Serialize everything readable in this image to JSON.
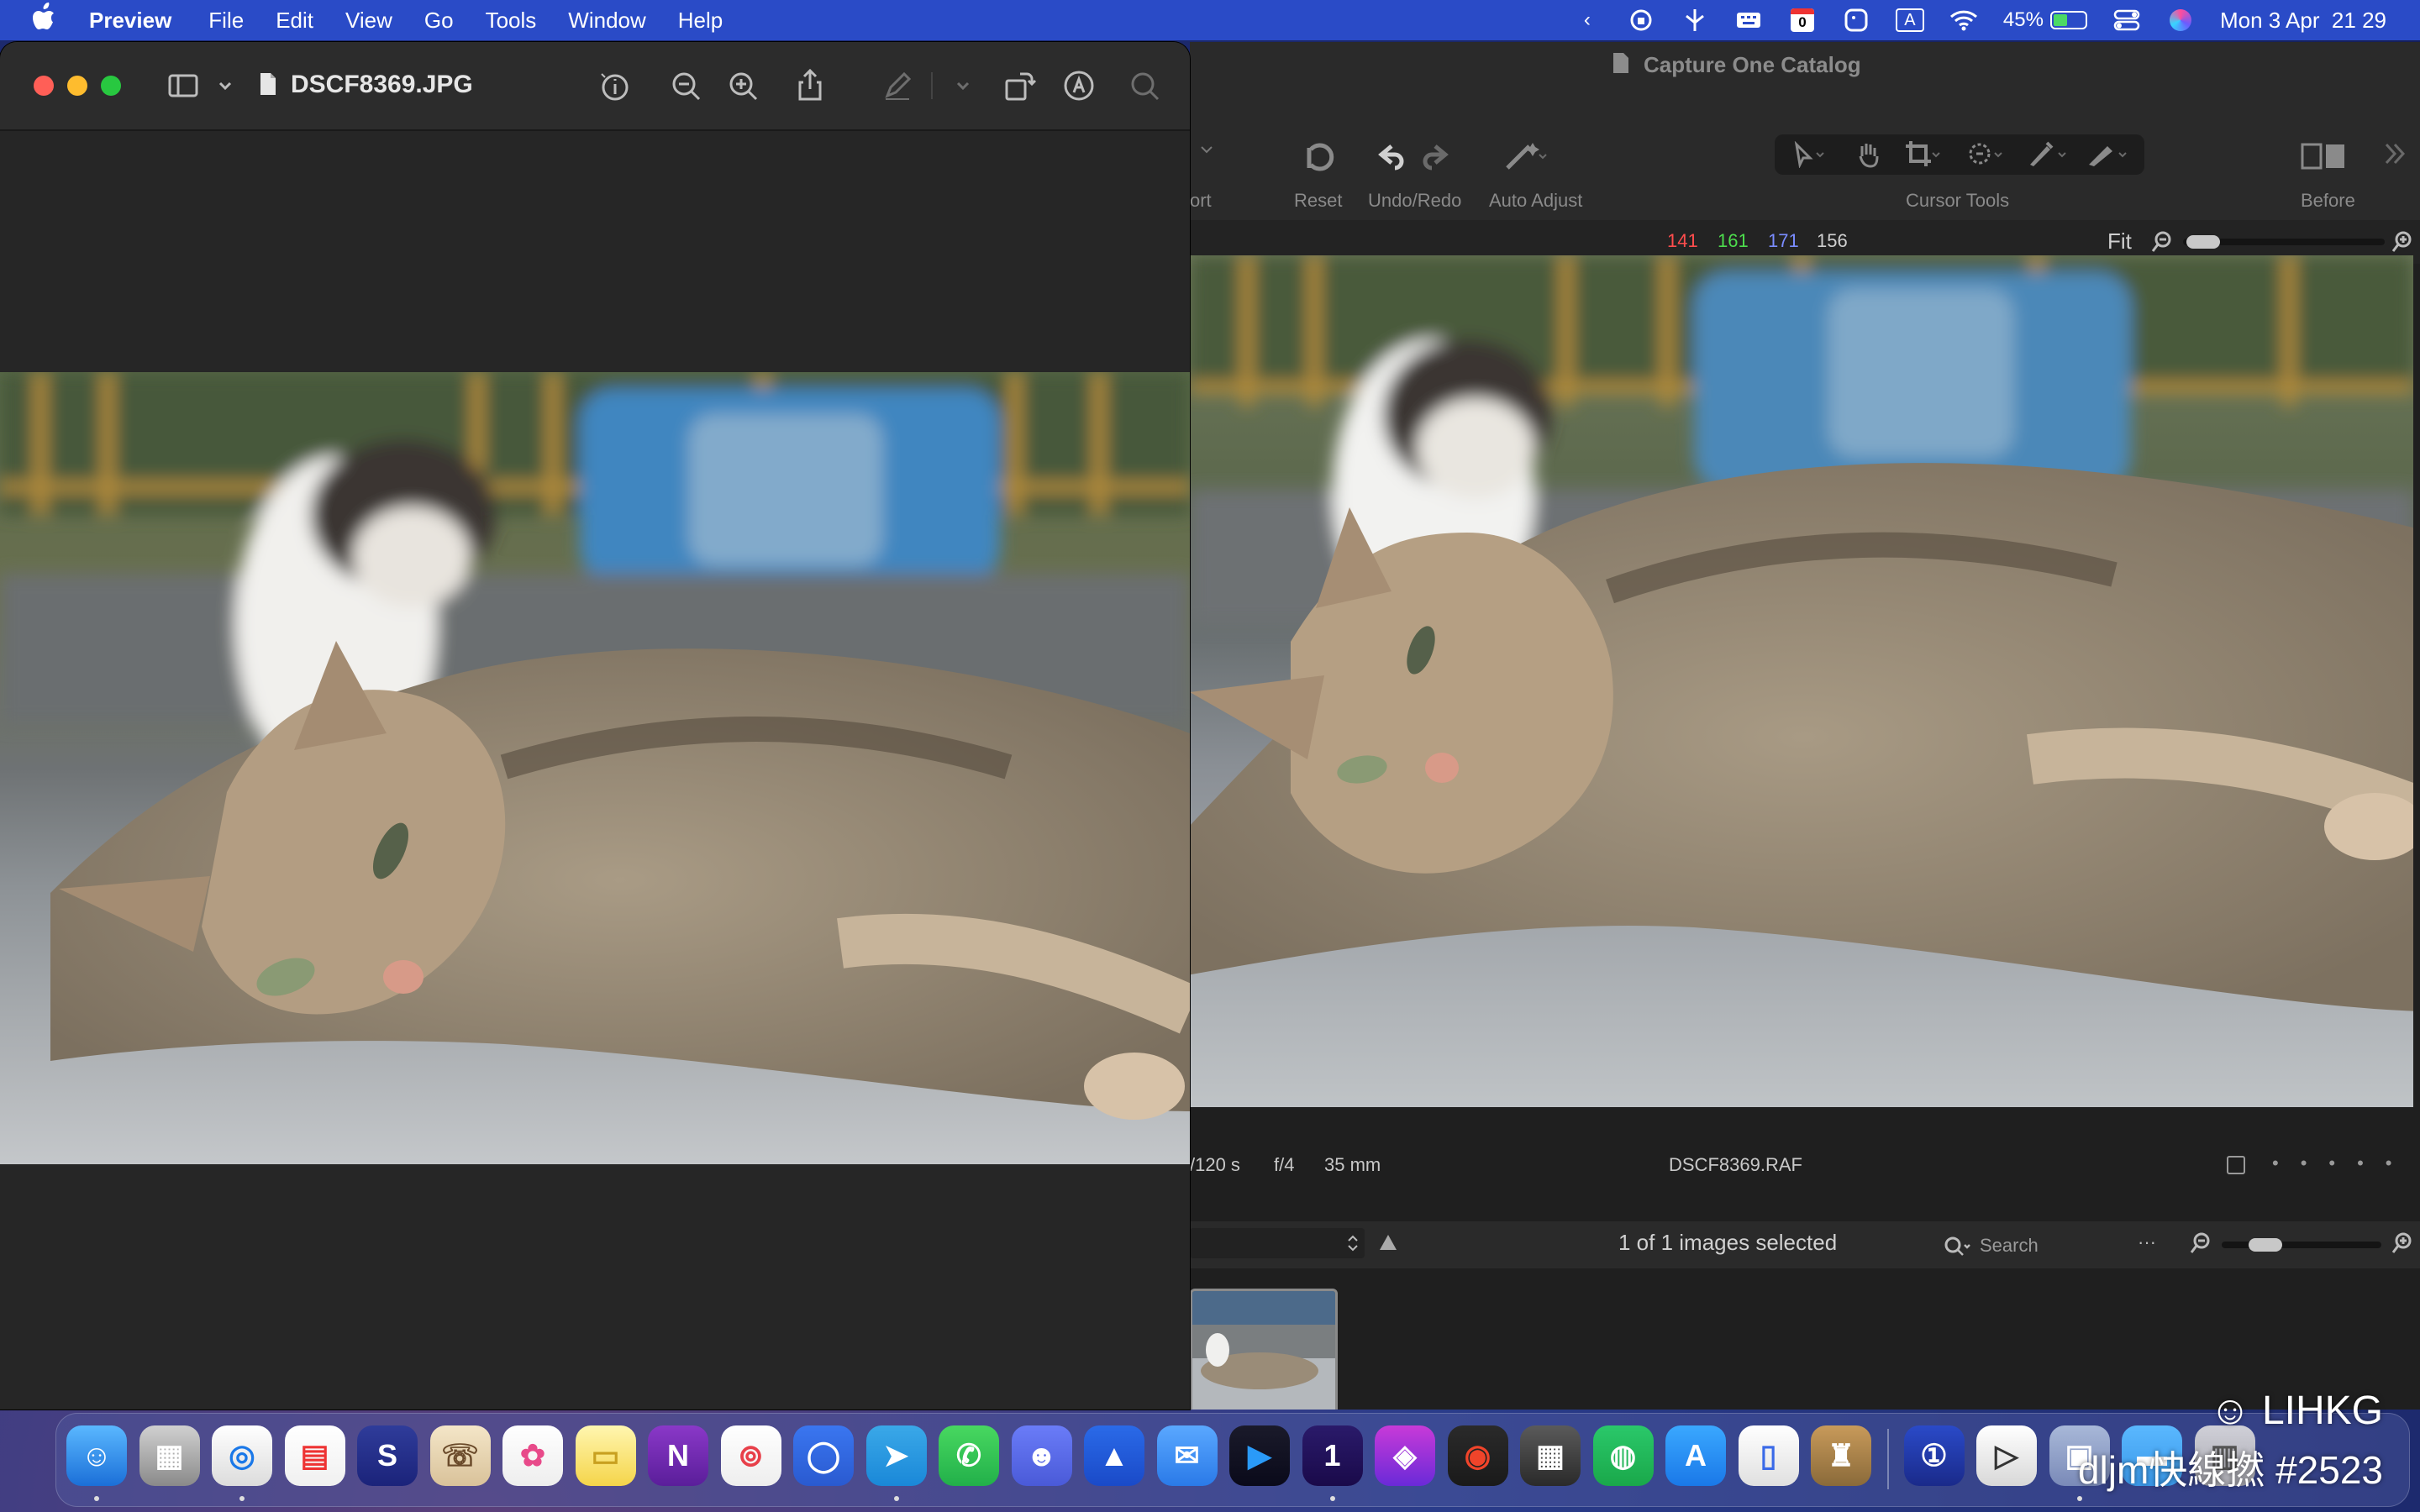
{
  "menubar": {
    "app": "Preview",
    "items": [
      "File",
      "Edit",
      "View",
      "Go",
      "Tools",
      "Window",
      "Help"
    ],
    "battery": "45%",
    "battery_level": 0.45,
    "datetime": "Mon 3 Apr  21 29",
    "calendar_day": "0",
    "input_source": "A"
  },
  "preview": {
    "filename": "DSCF8369.JPG",
    "icons": [
      "sidebar-toggle-icon",
      "chevron-down-icon",
      "info-icon",
      "zoom-out-icon",
      "zoom-in-icon",
      "share-icon",
      "markup-pen-icon",
      "rotate-icon",
      "markup-circle-icon",
      "search-icon"
    ]
  },
  "captureone": {
    "title": "Capture One Catalog",
    "toolbar": {
      "export_label": "ort",
      "reset_label": "Reset",
      "undo_redo_label": "Undo/Redo",
      "auto_adjust_label": "Auto Adjust",
      "cursor_tools_label": "Cursor Tools",
      "before_label": "Before"
    },
    "readout": {
      "r": "141",
      "g": "161",
      "b": "171",
      "l": "156"
    },
    "zoom_label": "Fit",
    "colors": {
      "red": "#ff4d4d",
      "green": "#4ddd4d",
      "blue": "#7a8cff"
    },
    "meta": {
      "shutter": "/120 s",
      "aperture": "f/4",
      "focal": "35 mm",
      "filename": "DSCF8369.RAF"
    },
    "browser": {
      "selection": "1 of 1 images selected",
      "search_placeholder": "Search"
    }
  },
  "dock": {
    "apps": [
      "Finder",
      "Launchpad",
      "Safari",
      "Fantastical",
      "Scrivener",
      "Contacts",
      "Photos",
      "Notes",
      "OneNote",
      "Pocket",
      "Signal",
      "Telegram",
      "WhatsApp",
      "Discord",
      "Spark",
      "Mail",
      "Infuse",
      "1Password",
      "Affinity Photo",
      "Capture One",
      "Calculator",
      "Evernote",
      "App Store",
      "Pages",
      "Archiver",
      "1Password 7",
      "Infuse 7",
      "Preview",
      "Folder",
      "Trash"
    ]
  },
  "watermark": {
    "site": "LIHKG",
    "user": "dljm快線撚 #2523"
  }
}
